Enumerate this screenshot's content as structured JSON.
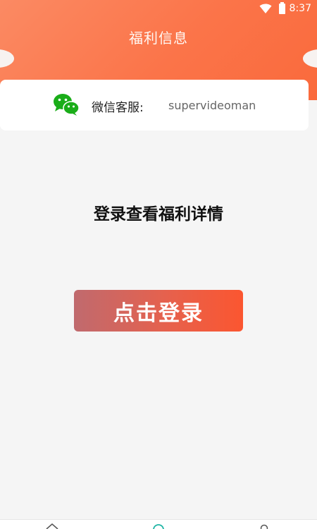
{
  "status_bar": {
    "time": "8:37"
  },
  "header": {
    "title": "福利信息"
  },
  "service": {
    "label": "微信客服:",
    "value": "supervideoman",
    "icon": "wechat-icon"
  },
  "main": {
    "prompt": "登录查看福利详情",
    "login_button_label": "点击登录"
  },
  "bottom_nav": {
    "items": [
      {
        "icon": "home-icon"
      },
      {
        "icon": "discover-icon"
      },
      {
        "icon": "user-icon"
      }
    ]
  },
  "colors": {
    "accent": "#fb7449",
    "button_start": "#c06a6e",
    "button_end": "#fb5630",
    "wechat_green": "#1aad19"
  }
}
